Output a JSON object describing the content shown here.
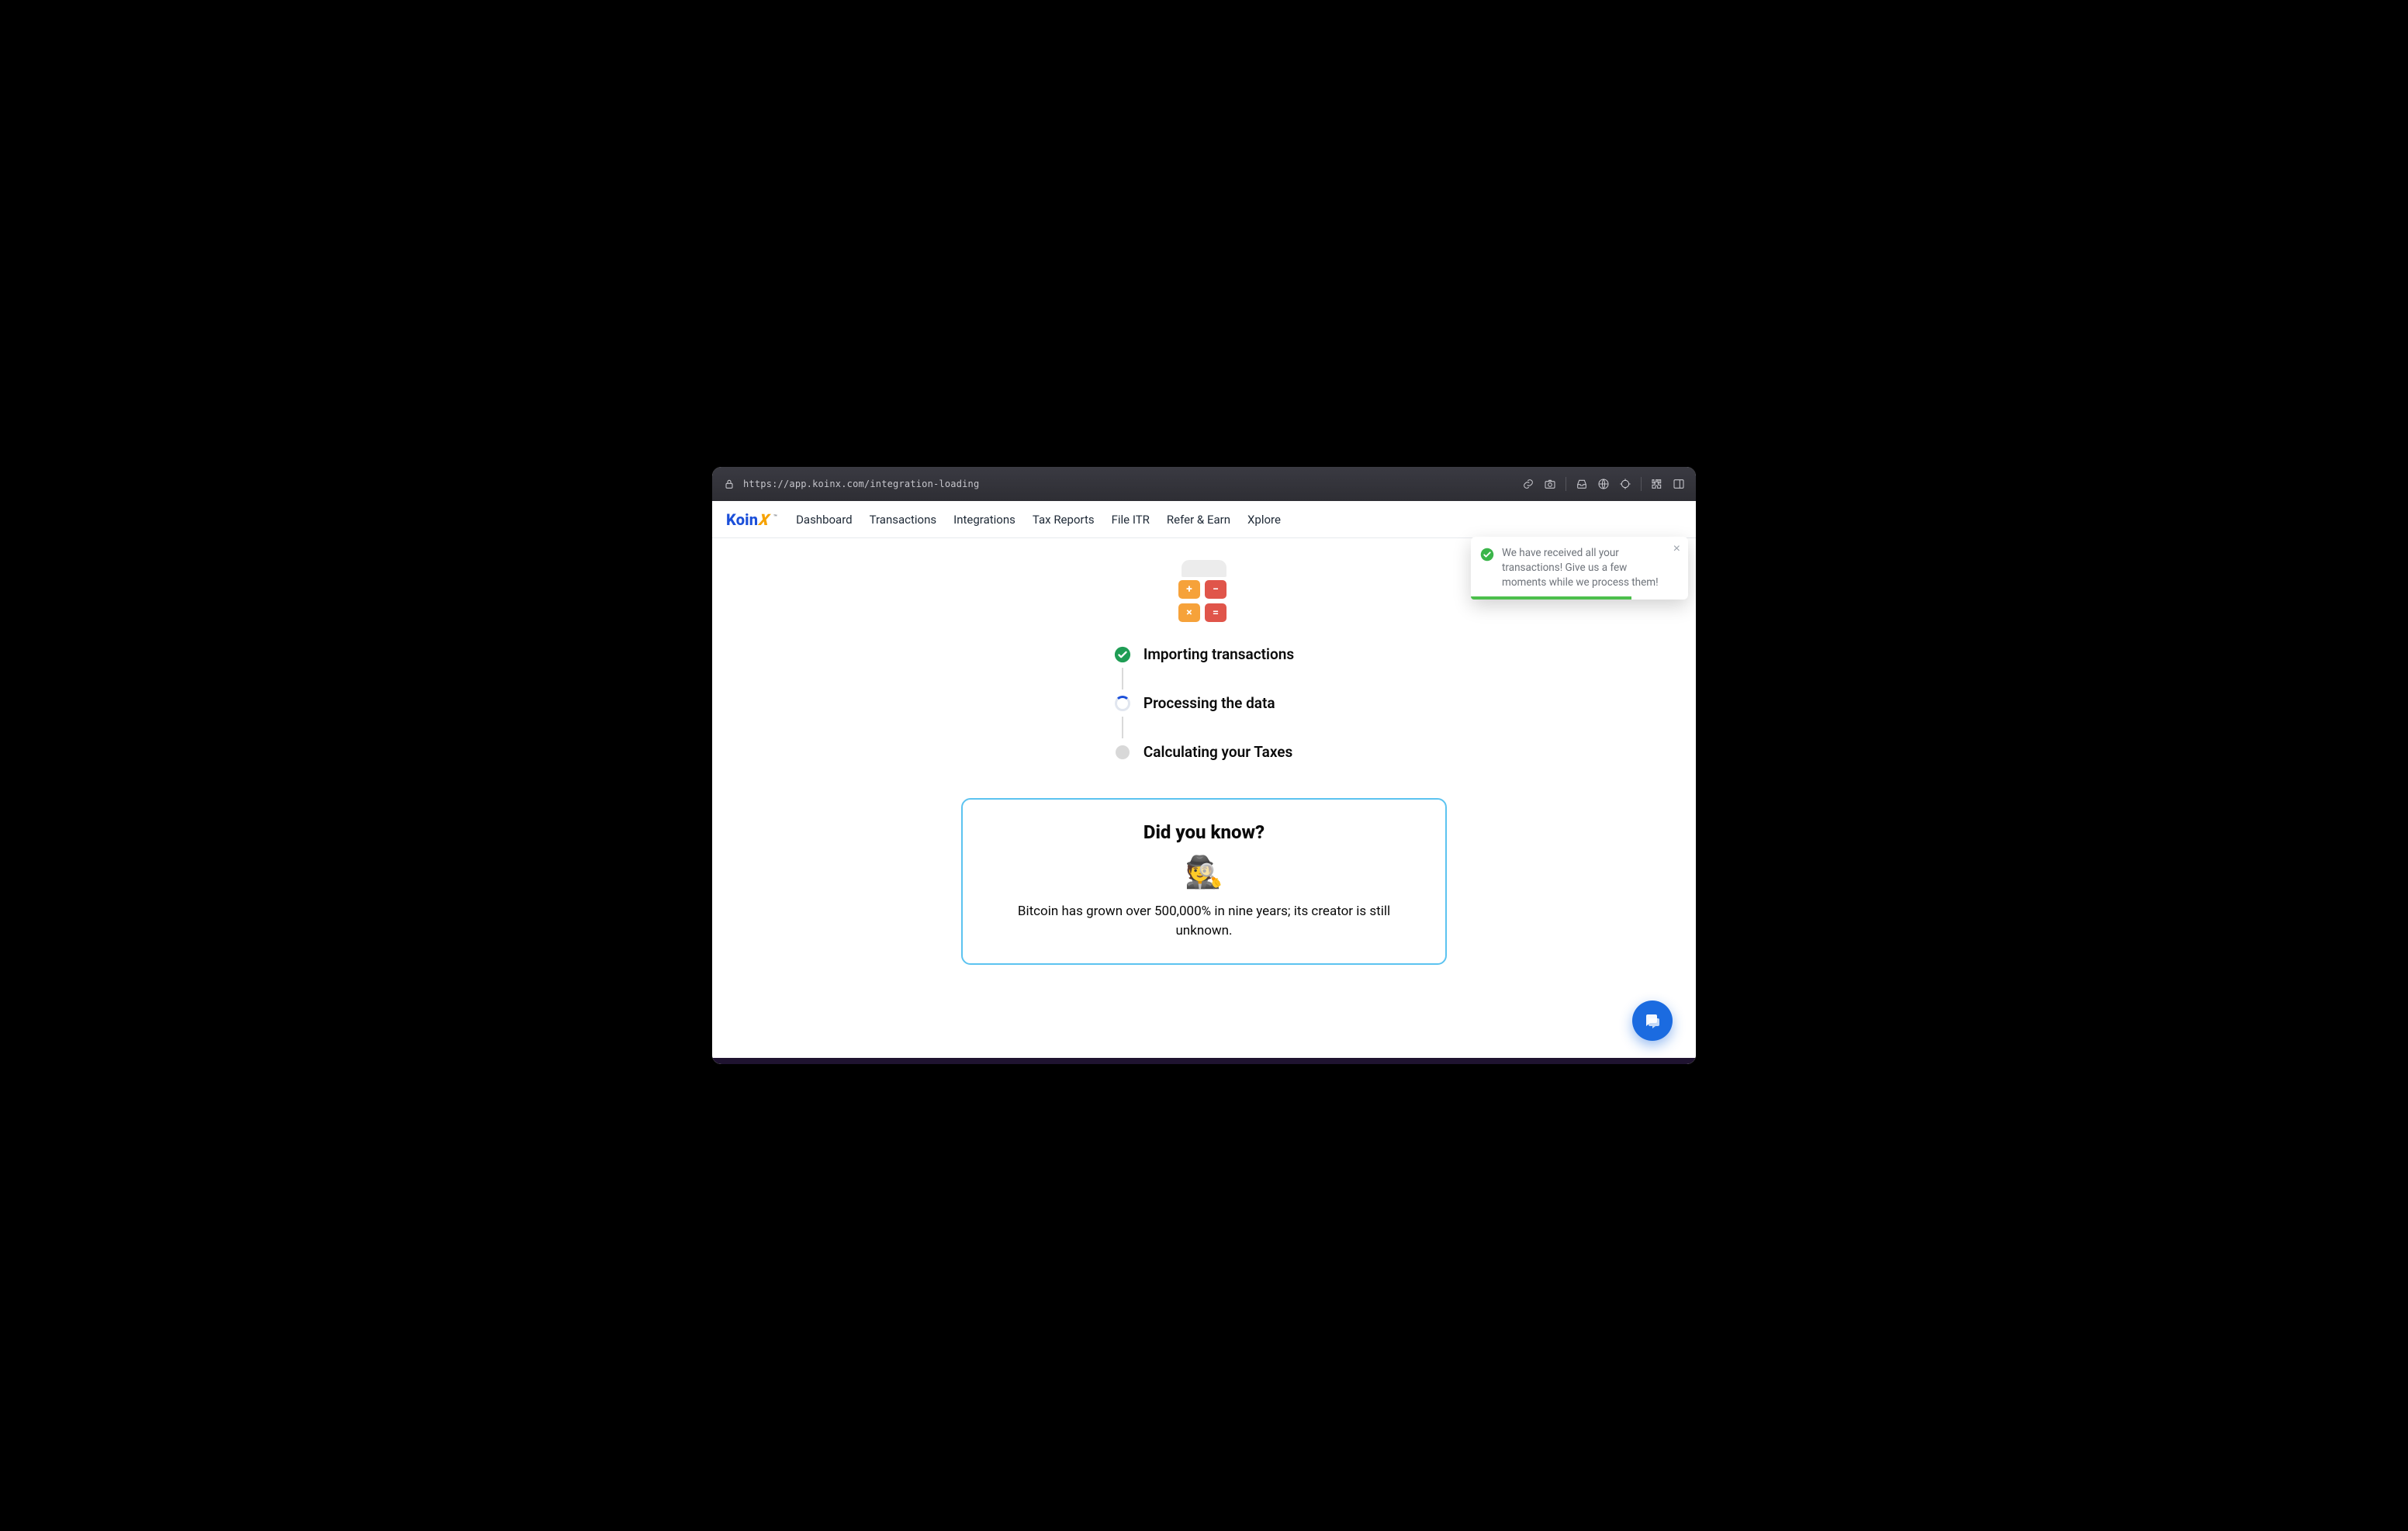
{
  "browser": {
    "url": "https://app.koinx.com/integration-loading"
  },
  "brand": {
    "part1": "Koin",
    "part2": "X",
    "tm": "™"
  },
  "nav": {
    "items": [
      "Dashboard",
      "Transactions",
      "Integrations",
      "Tax Reports",
      "File ITR",
      "Refer & Earn",
      "Xplore"
    ]
  },
  "steps": {
    "s1": "Importing transactions",
    "s2": "Processing the data",
    "s3": "Calculating your Taxes"
  },
  "didYouKnow": {
    "title": "Did you know?",
    "emoji": "🕵️",
    "text": "Bitcoin has grown over 500,000% in nine years; its creator is still unknown."
  },
  "toast": {
    "message": "We have received all your transactions! Give us a few moments while we process them!"
  },
  "calc_keys": {
    "plus": "+",
    "minus": "−",
    "times": "×",
    "equals": "="
  }
}
